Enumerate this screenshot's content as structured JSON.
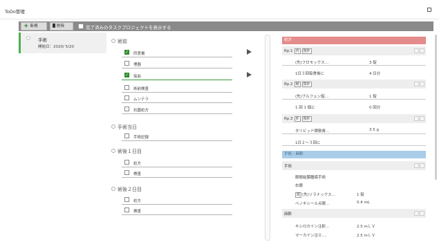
{
  "window": {
    "title": "ToDo管理"
  },
  "toolbar": {
    "new_label": "新規",
    "delete_label": "削除",
    "show_completed_label": "完了済みのタスクプロジェクトを表示する",
    "show_completed_checked": false
  },
  "projects": [
    {
      "name": "手術",
      "start_date": "開始日：2020/ 5/20"
    }
  ],
  "task_groups": [
    {
      "name": "術前",
      "tasks": [
        {
          "label": "同意書",
          "checked": true,
          "has_arrow": true
        },
        {
          "label": "埋器",
          "checked": false,
          "has_arrow": false
        },
        {
          "label": "採血",
          "checked": true,
          "has_arrow": true
        },
        {
          "label": "術前検査",
          "checked": false,
          "has_arrow": false
        },
        {
          "label": "ムンテラ",
          "checked": false,
          "has_arrow": false
        },
        {
          "label": "抗菌処方",
          "checked": false,
          "has_arrow": false
        }
      ]
    },
    {
      "name": "手術当日",
      "tasks": [
        {
          "label": "手術記録",
          "checked": false,
          "has_arrow": false
        }
      ]
    },
    {
      "name": "術後１日目",
      "tasks": [
        {
          "label": "処方",
          "checked": false,
          "has_arrow": false
        },
        {
          "label": "検査",
          "checked": false,
          "has_arrow": false
        }
      ]
    },
    {
      "name": "術後２日目",
      "tasks": [
        {
          "label": "処方",
          "checked": false,
          "has_arrow": false
        },
        {
          "label": "検査",
          "checked": false,
          "has_arrow": false
        }
      ]
    }
  ],
  "detail": {
    "prescription": {
      "header": "処方",
      "rps": [
        {
          "label": "Rp.1",
          "tags": [
            "内",
            "院外"
          ],
          "drug_name": "(先)フロモックス…",
          "drug_qty": "3 錠",
          "usage": "1日３回毎食後に",
          "days": "4 日分"
        },
        {
          "label": "Rp.2",
          "tags": [
            "頓",
            "院外"
          ],
          "drug_name": "(先)ブルフェン錠…",
          "drug_qty": "1 錠",
          "usage": "1 回 1 個に",
          "days": "0 回分"
        },
        {
          "label": "Rp.3",
          "tags": [
            "外",
            "院外"
          ],
          "drug_name": "タリビッド眼軟膏…",
          "drug_qty": "3.5 g",
          "usage": "1日２～３回に"
        }
      ]
    },
    "surgery": {
      "header": "手術・麻酔",
      "sub_header": "手術",
      "procedure": "眼瞼結膜腫瘍手術",
      "side": "右眼",
      "item1_tag": "局",
      "item1_name": "(先)ソラナックス…",
      "item1_qty": "1 錠",
      "item2_name": "ベノキシール点眼…",
      "item2_qty": "0.4 mL",
      "anesthesia_header": "麻酔",
      "anes1_name": "キシロカイン注射…",
      "anes1_qty": "2.5 mＬＶ",
      "anes2_name": "マーカイン注０.…",
      "anes2_qty": "2.5 mＬＶ"
    }
  }
}
